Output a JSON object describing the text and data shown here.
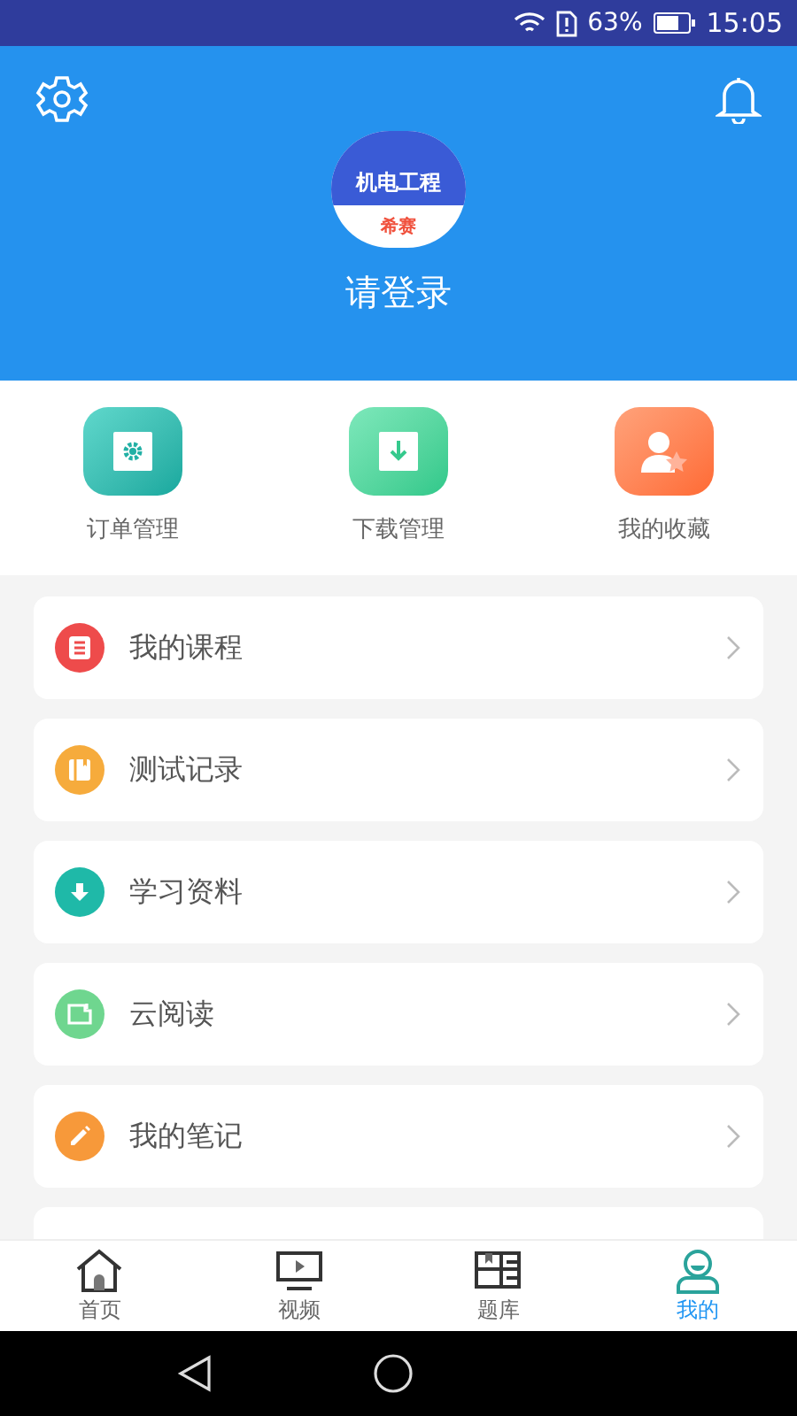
{
  "status_bar": {
    "battery_text": "63%",
    "time": "15:05"
  },
  "header": {
    "logo": {
      "title": "机电工程",
      "subtitle": "希赛"
    },
    "login": "请登录"
  },
  "quick_actions": [
    {
      "kind": "order",
      "label": "订单管理"
    },
    {
      "kind": "download",
      "label": "下载管理"
    },
    {
      "kind": "favorite",
      "label": "我的收藏"
    }
  ],
  "menu": [
    {
      "kind": "list",
      "label": "我的课程",
      "color": "#ee4b4b"
    },
    {
      "kind": "book",
      "label": "测试记录",
      "color": "#f6ab3c"
    },
    {
      "kind": "download",
      "label": "学习资料",
      "color": "#1fb9a8"
    },
    {
      "kind": "reader",
      "label": "云阅读",
      "color": "#6fd68f"
    },
    {
      "kind": "pencil",
      "label": "我的笔记",
      "color": "#f7993a"
    }
  ],
  "tabs": [
    {
      "kind": "home",
      "label": "首页",
      "selected": false
    },
    {
      "kind": "video",
      "label": "视频",
      "selected": false
    },
    {
      "kind": "bank",
      "label": "题库",
      "selected": false
    },
    {
      "kind": "me",
      "label": "我的",
      "selected": true
    }
  ]
}
